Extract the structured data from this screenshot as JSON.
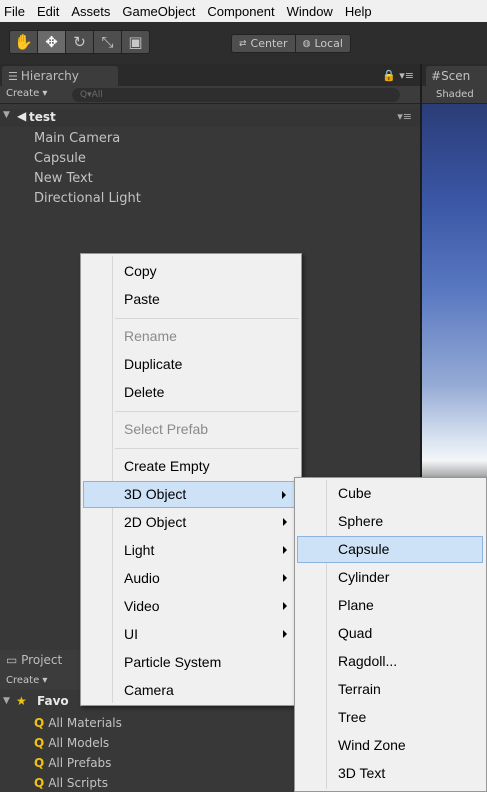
{
  "menubar": {
    "items": [
      "File",
      "Edit",
      "Assets",
      "GameObject",
      "Component",
      "Window",
      "Help"
    ]
  },
  "toolbar": {
    "tools": [
      {
        "icon": "hand-icon",
        "glyph": "✋"
      },
      {
        "icon": "move-icon",
        "glyph": "✥"
      },
      {
        "icon": "rotate-icon",
        "glyph": "↻"
      },
      {
        "icon": "scale-icon",
        "glyph": "⤡"
      },
      {
        "icon": "rect-icon",
        "glyph": "▣"
      }
    ],
    "pivot_label": "Center",
    "space_label": "Local"
  },
  "hierarchy": {
    "tab_label": "Hierarchy",
    "create_label": "Create ▾",
    "search_placeholder": "Q▾All",
    "scene_name": "test",
    "items": [
      "Main Camera",
      "Capsule",
      "New Text",
      "Directional Light"
    ]
  },
  "scene": {
    "tab_label": "Scen",
    "shading_label": "Shaded"
  },
  "project": {
    "tab_label": "Project",
    "create_label": "Create ▾",
    "favorites_label": "Favo",
    "favorites": [
      "All Materials",
      "All Models",
      "All Prefabs",
      "All Scripts"
    ]
  },
  "context_menu": {
    "items": [
      {
        "label": "Copy",
        "disabled": false,
        "submenu": false
      },
      {
        "label": "Paste",
        "disabled": false,
        "submenu": false
      },
      {
        "label": "Rename",
        "disabled": true,
        "submenu": false
      },
      {
        "label": "Duplicate",
        "disabled": false,
        "submenu": false
      },
      {
        "label": "Delete",
        "disabled": false,
        "submenu": false
      },
      {
        "label": "Select Prefab",
        "disabled": true,
        "submenu": false
      },
      {
        "label": "Create Empty",
        "disabled": false,
        "submenu": false
      },
      {
        "label": "3D Object",
        "disabled": false,
        "submenu": true,
        "highlighted": true
      },
      {
        "label": "2D Object",
        "disabled": false,
        "submenu": true
      },
      {
        "label": "Light",
        "disabled": false,
        "submenu": true
      },
      {
        "label": "Audio",
        "disabled": false,
        "submenu": true
      },
      {
        "label": "Video",
        "disabled": false,
        "submenu": true
      },
      {
        "label": "UI",
        "disabled": false,
        "submenu": true
      },
      {
        "label": "Particle System",
        "disabled": false,
        "submenu": false
      },
      {
        "label": "Camera",
        "disabled": false,
        "submenu": false
      }
    ]
  },
  "submenu_3d": {
    "items": [
      {
        "label": "Cube"
      },
      {
        "label": "Sphere"
      },
      {
        "label": "Capsule",
        "highlighted": true
      },
      {
        "label": "Cylinder"
      },
      {
        "label": "Plane"
      },
      {
        "label": "Quad"
      },
      {
        "label": "Ragdoll..."
      },
      {
        "label": "Terrain"
      },
      {
        "label": "Tree"
      },
      {
        "label": "Wind Zone"
      },
      {
        "label": "3D Text"
      }
    ]
  },
  "colors": {
    "menu_highlight": "#cde2f6",
    "menu_highlight_border": "#8db4e0",
    "editor_bg": "#383838",
    "favorite_icon": "#f4c20d"
  }
}
